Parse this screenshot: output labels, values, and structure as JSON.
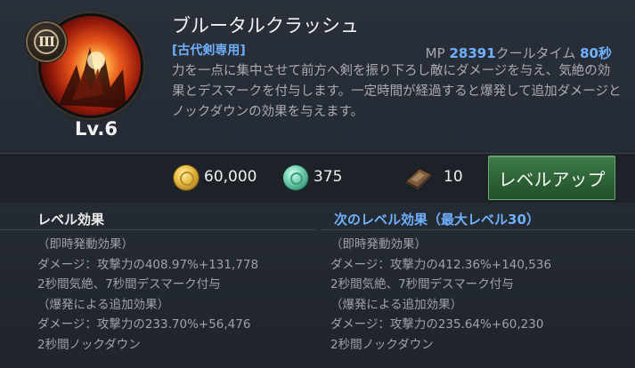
{
  "skill": {
    "name": "ブルータルクラッシュ",
    "weapon_tag": "[古代剣専用]",
    "level": "Lv.6",
    "rank": "III",
    "mp_label": "MP",
    "mp_value": "28391",
    "cooldown_label": "クールタイム",
    "cooldown_value": "80秒",
    "description": "力を一点に集中させて前方へ剣を振り下ろし敵にダメージを与え、気絶の効果とデスマークを付与します。一定時間が経過すると爆発して追加ダメージとノックダウンの効果を与えます。"
  },
  "cost": {
    "gold": "60,000",
    "jade": "375",
    "book": "10"
  },
  "levelup_button": "レベルアップ",
  "current_effects": {
    "title": "レベル効果",
    "lines": [
      "（即時発動効果）",
      "ダメージ：攻撃力の408.97%+131,778",
      "2秒間気絶、7秒間デスマーク付与",
      "（爆発による追加効果）",
      "ダメージ：攻撃力の233.70%+56,476",
      "2秒間ノックダウン"
    ]
  },
  "next_effects": {
    "title": "次のレベル効果（最大レベル30）",
    "lines": [
      "（即時発動効果）",
      "ダメージ：攻撃力の412.36%+140,536",
      "2秒間気絶、7秒間デスマーク付与",
      "（爆発による追加効果）",
      "ダメージ：攻撃力の235.64%+60,230",
      "2秒間ノックダウン"
    ]
  },
  "colors": {
    "accent_blue": "#6fb1ff",
    "button_green": "#2d6236"
  },
  "icons": {
    "skill": "fire-crush-icon",
    "gold": "gold-coin-icon",
    "jade": "jade-coin-icon",
    "book": "skill-book-icon",
    "rank": "rank-badge-icon"
  }
}
